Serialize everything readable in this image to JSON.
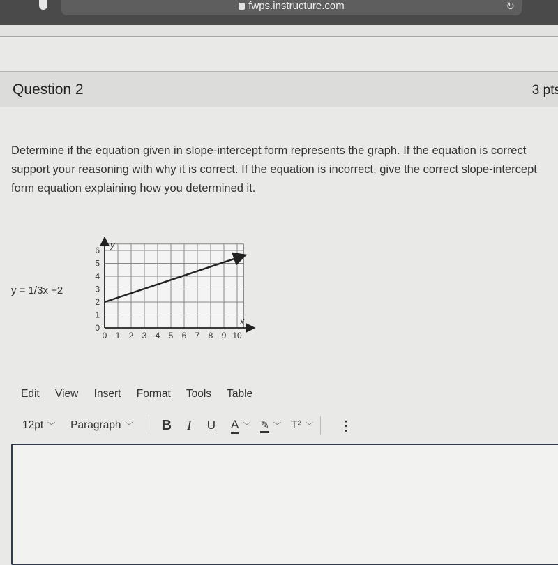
{
  "browser": {
    "url": "fwps.instructure.com",
    "icons": [
      "shield-icon",
      "lock-icon",
      "reload-icon"
    ]
  },
  "question": {
    "title": "Question 2",
    "points": "3 pts",
    "prompt": "Determine if the equation given in slope-intercept form represents the graph. If the equation is correct support your reasoning with why it is correct.  If the equation is incorrect, give the correct slope-intercept form equation explaining how you determined it.",
    "equation": "y = 1/3x +2"
  },
  "chart_data": {
    "type": "line",
    "title": "",
    "xlabel": "x",
    "ylabel": "y",
    "xlim": [
      0,
      10
    ],
    "ylim": [
      0,
      6
    ],
    "x_ticks": [
      "0",
      "1",
      "2",
      "3",
      "4",
      "5",
      "6",
      "7",
      "8",
      "9",
      "10"
    ],
    "y_ticks": [
      "0",
      "1",
      "2",
      "3",
      "4",
      "5",
      "6"
    ],
    "grid": true,
    "series": [
      {
        "name": "line",
        "x": [
          0,
          10.5
        ],
        "y": [
          2,
          5.6
        ],
        "arrow_end": true
      }
    ]
  },
  "editor": {
    "menu": [
      "Edit",
      "View",
      "Insert",
      "Format",
      "Tools",
      "Table"
    ],
    "font_size": "12pt",
    "block_format": "Paragraph",
    "buttons": {
      "bold": "B",
      "italic": "I",
      "underline": "U",
      "text_color": "A",
      "superscript": "T²",
      "more": "⋮"
    }
  }
}
